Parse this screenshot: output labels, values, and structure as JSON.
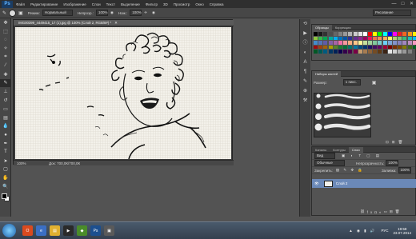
{
  "app": {
    "logo": "Ps"
  },
  "menu": [
    "Файл",
    "Редактирование",
    "Изображение",
    "Слои",
    "Текст",
    "Выделение",
    "Фильтр",
    "3D",
    "Просмотр",
    "Окно",
    "Справка"
  ],
  "window_buttons": [
    "—",
    "□",
    "✕"
  ],
  "options": {
    "mode_label": "Режим:",
    "mode_value": "Нормальный",
    "opacity_label": "Непрозр.:",
    "opacity_value": "100%",
    "press_label": "Наж.:",
    "press_value": "100%",
    "workspace": "Рисование"
  },
  "document": {
    "title": "IMG00399_4449415_17 (1).jpg @ 100% (Слой 2, RGB/8#) *",
    "zoom": "100%",
    "doc_info": "Док: 700,0К/700,0К"
  },
  "swatches_panel": {
    "tabs": [
      "Образцы",
      "Коррекция"
    ],
    "colors": [
      "#000000",
      "#1a1a1a",
      "#333333",
      "#4d4d4d",
      "#666666",
      "#808080",
      "#999999",
      "#b3b3b3",
      "#cccccc",
      "#e6e6e6",
      "#ffffff",
      "#ff0000",
      "#ffff00",
      "#00ff00",
      "#00ffff",
      "#0000ff",
      "#ff00ff",
      "#ed1c24",
      "#f26522",
      "#f7941d",
      "#fff200",
      "#8dc63f",
      "#39b54a",
      "#00a651",
      "#00a99d",
      "#00aeef",
      "#0072bc",
      "#0054a6",
      "#2e3192",
      "#662d91",
      "#92278f",
      "#9e005d",
      "#ed145b",
      "#f26c4f",
      "#f68e56",
      "#fbaf5d",
      "#fff568",
      "#acd373",
      "#7cc576",
      "#3cb878",
      "#1cbbb4",
      "#00bff3",
      "#448ccb",
      "#5674b9",
      "#605ca8",
      "#8560a8",
      "#a864a8",
      "#f06eaa",
      "#f6989d",
      "#f9ad81",
      "#fdc689",
      "#fff799",
      "#c4df9b",
      "#a3d39c",
      "#82ca9c",
      "#7accc8",
      "#6dcff6",
      "#7da7d9",
      "#8393ca",
      "#8781bd",
      "#a187be",
      "#bc8dbf",
      "#f49ac1",
      "#9e0b0f",
      "#a0410d",
      "#a3620a",
      "#aba000",
      "#598527",
      "#1a7b30",
      "#007236",
      "#00746b",
      "#0076a3",
      "#004a80",
      "#003471",
      "#1b1464",
      "#440e62",
      "#630460",
      "#9e0039",
      "#790000",
      "#7b2e00",
      "#7d4900",
      "#827b00",
      "#406618",
      "#005e20",
      "#005826",
      "#005952",
      "#005b7f",
      "#003663",
      "#002157",
      "#0d004c",
      "#32004b",
      "#4b0049",
      "#7b0046",
      "#c69c6d",
      "#a67c52",
      "#8c6239",
      "#754c24",
      "#603913",
      "#3c2415",
      "#e6e6e6",
      "#cccccc",
      "#b3b3b3",
      "#999999",
      "#808080"
    ]
  },
  "brush_panel": {
    "tabs": [
      "Наборы кистей"
    ],
    "size_label": "Размер:",
    "size_value": "1 пикс."
  },
  "layers_panel": {
    "tabs": [
      "Каналы",
      "Контуры",
      "Слои"
    ],
    "kind": "Вид",
    "blend_mode": "Обычные",
    "opacity_label": "Непрозрачность:",
    "opacity_value": "100%",
    "lock_label": "Закрепить:",
    "fill_label": "Заливка:",
    "fill_value": "100%",
    "layer_name": "Слой 2"
  },
  "taskbar": {
    "lang": "РУС",
    "time": "19:58",
    "date": "23.07.2014"
  }
}
